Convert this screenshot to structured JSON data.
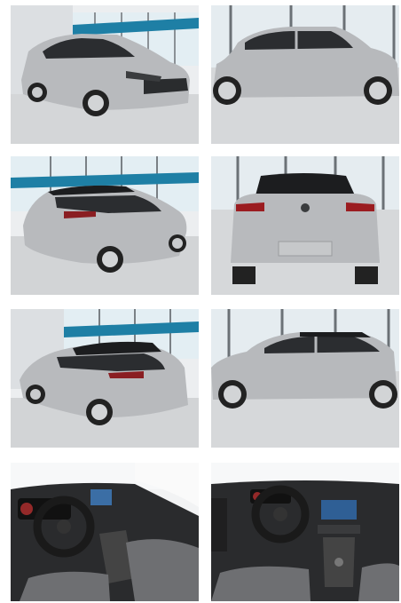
{
  "gallery": {
    "photos": [
      {
        "view": "front-three-quarter",
        "scene": "showroom"
      },
      {
        "view": "side-profile",
        "scene": "showroom"
      },
      {
        "view": "rear-three-quarter",
        "scene": "showroom"
      },
      {
        "view": "rear",
        "scene": "showroom"
      },
      {
        "view": "rear-three-quarter-left",
        "scene": "showroom"
      },
      {
        "view": "side-profile-left",
        "scene": "showroom"
      },
      {
        "view": "interior-dashboard-left",
        "scene": "interior"
      },
      {
        "view": "interior-dashboard-center",
        "scene": "interior"
      }
    ]
  },
  "colors": {
    "car_body": "#b7b9bc",
    "roof": "#1c1d1f",
    "wall": "#e9ecef",
    "window": "#e3eef3",
    "accent_stripe": "#1e7fa5",
    "floor": "#d0d2d4",
    "interior_dark": "#2a2b2d",
    "seat_fabric": "#6e6f72"
  }
}
